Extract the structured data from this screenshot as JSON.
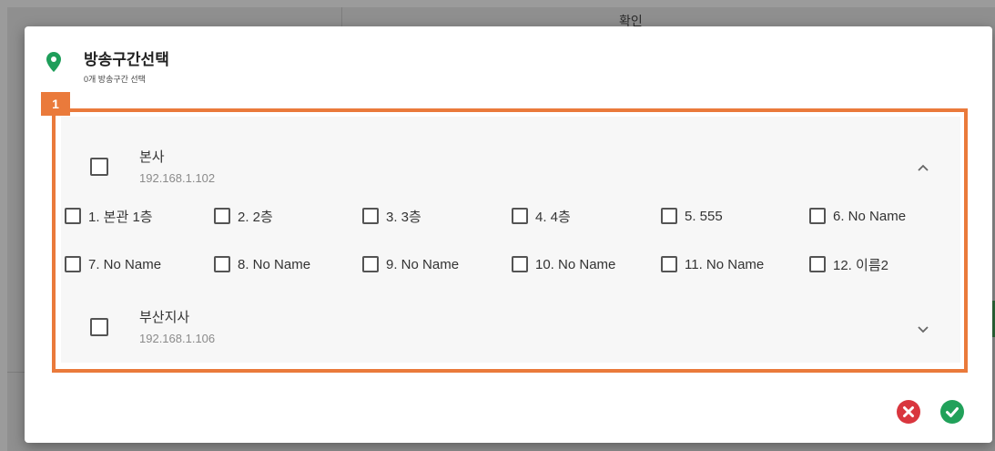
{
  "background": {
    "header_text": "확인"
  },
  "dialog": {
    "title": "방송구간선택",
    "subtitle": "0개 방송구간 선택",
    "annotation_label": "1",
    "groups": [
      {
        "name": "본사",
        "ip": "192.168.1.102",
        "expanded": true,
        "zones": [
          "1. 본관 1층",
          "2. 2층",
          "3. 3층",
          "4. 4층",
          "5. 555",
          "6. No Name",
          "7. No Name",
          "8. No Name",
          "9. No Name",
          "10. No Name",
          "11. No Name",
          "12. 이름2"
        ]
      },
      {
        "name": "부산지사",
        "ip": "192.168.1.106",
        "expanded": false,
        "zones": []
      }
    ]
  },
  "colors": {
    "annotation": "#ea7a3b",
    "cancel": "#d9363e",
    "confirm": "#21a15a",
    "location_icon": "#1e9e5a"
  },
  "icons": {
    "header": "location-pin-icon",
    "expand": "chevron-up-icon",
    "collapse": "chevron-down-icon",
    "cancel": "cancel-circle-icon",
    "confirm": "check-circle-icon"
  }
}
